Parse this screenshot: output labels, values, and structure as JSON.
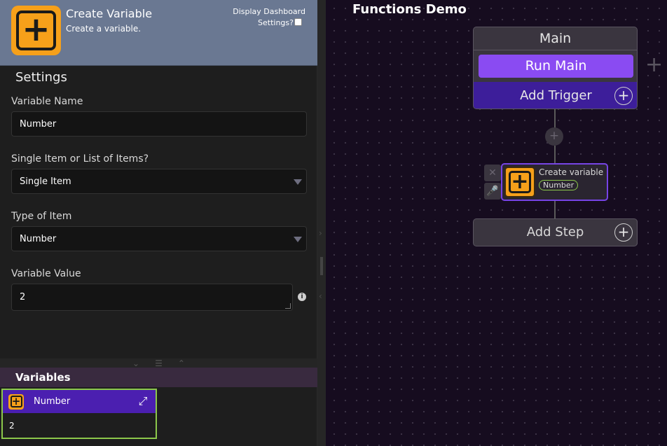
{
  "header": {
    "title": "Create Variable",
    "subtitle": "Create a variable.",
    "dashboard_label_line1": "Display Dashboard",
    "dashboard_label_line2": "Settings?",
    "icon": "plus-square-icon"
  },
  "settings": {
    "heading": "Settings",
    "fields": [
      {
        "label": "Variable Name",
        "value": "Number"
      },
      {
        "label": "Single Item or List of Items?",
        "value": "Single Item"
      },
      {
        "label": "Type of Item",
        "value": "Number"
      },
      {
        "label": "Variable Value",
        "value": "2"
      }
    ]
  },
  "variables": {
    "heading": "Variables",
    "items": [
      {
        "name": "Number",
        "value": "2"
      }
    ]
  },
  "canvas": {
    "title": "Functions Demo",
    "main_node": {
      "title": "Main",
      "run_label": "Run Main",
      "add_trigger_label": "Add Trigger"
    },
    "step_node": {
      "title": "Create variable",
      "badge": "Number"
    },
    "add_step_label": "Add Step"
  },
  "colors": {
    "accent_purple": "#8a4bf2",
    "trigger_purple": "#3d1e9a",
    "icon_orange": "#f6a01a",
    "variable_green": "#8cc84b",
    "header_slate": "#6a7892"
  }
}
